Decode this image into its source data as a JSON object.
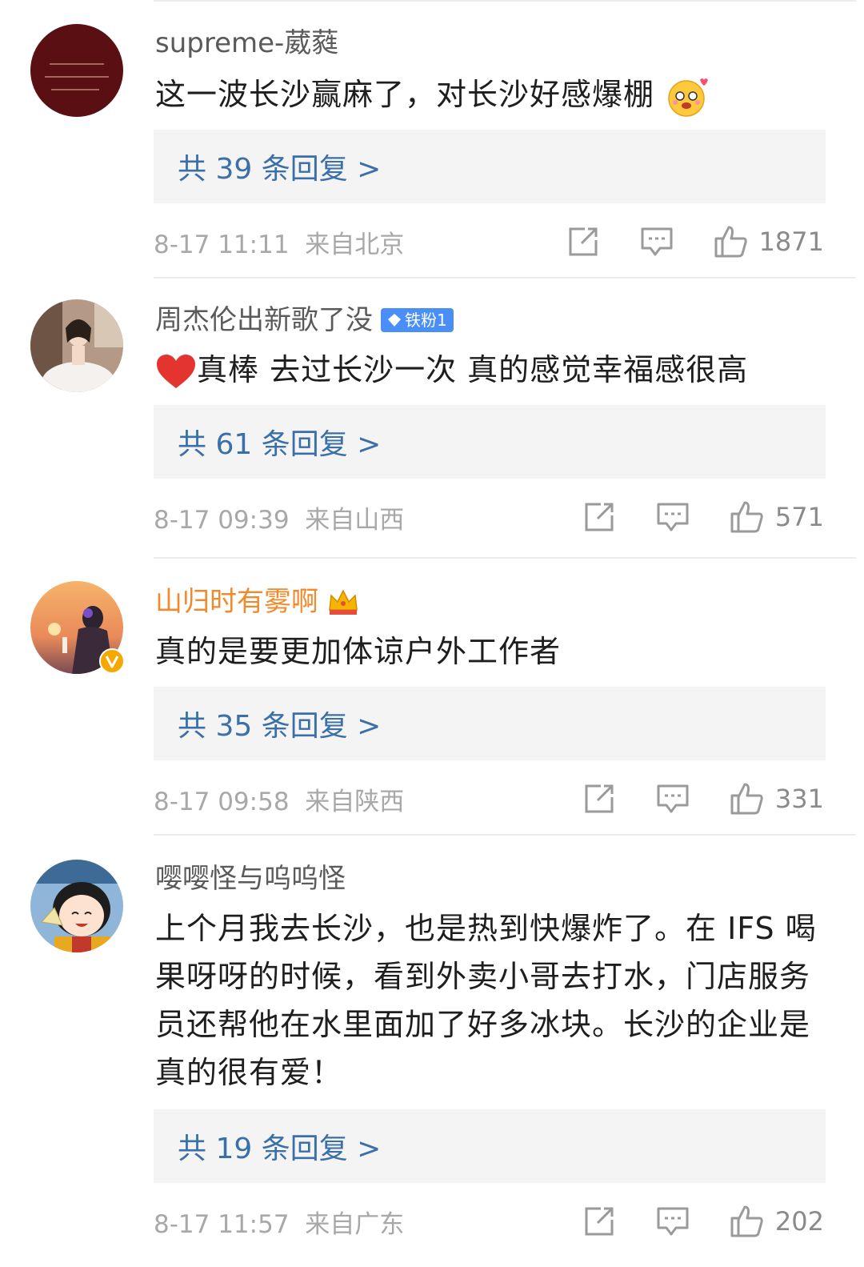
{
  "comments": [
    {
      "username": "supreme-葳蕤",
      "content": "这一波长沙赢麻了，对长沙好感爆棚",
      "replies_label": "共 39 条回复 >",
      "timestamp": "8-17 11:11",
      "location": "来自北京",
      "likes": "1871",
      "avatar_icon": "calligraphy-avatar",
      "emoji_icon": "blushing-face-emoji"
    },
    {
      "username": "周杰伦出新歌了没",
      "badge": "铁粉1",
      "content": "真棒 去过长沙一次 真的感觉幸福感很高",
      "replies_label": "共 61 条回复 >",
      "timestamp": "8-17 09:39",
      "location": "来自山西",
      "likes": "571",
      "avatar_icon": "bride-photo-avatar",
      "emoji_icon": "red-heart-emoji"
    },
    {
      "username": "山归时有雾啊",
      "content": "真的是要更加体谅户外工作者",
      "replies_label": "共 35 条回复 >",
      "timestamp": "8-17 09:58",
      "location": "来自陕西",
      "likes": "331",
      "avatar_icon": "sunset-girl-avatar",
      "badge_icon": "crown-icon",
      "verified_icon": "verified-v-icon"
    },
    {
      "username": "嘤嘤怪与呜呜怪",
      "content": "上个月我去长沙，也是热到快爆炸了。在 IFS 喝果呀呀的时候，看到外卖小哥去打水，门店服务员还帮他在水里面加了好多冰块。长沙的企业是真的很有爱！",
      "replies_label": "共 19 条回复 >",
      "timestamp": "8-17 11:57",
      "location": "来自广东",
      "likes": "202",
      "avatar_icon": "cartoon-girl-avatar"
    }
  ],
  "colors": {
    "username": "#5a5a5a",
    "vip_username": "#f08a2c",
    "reply_link": "#3b6fa8",
    "reply_bg": "#f4f4f4",
    "meta": "#a8a8a8",
    "badge": "#4a8ef7"
  }
}
